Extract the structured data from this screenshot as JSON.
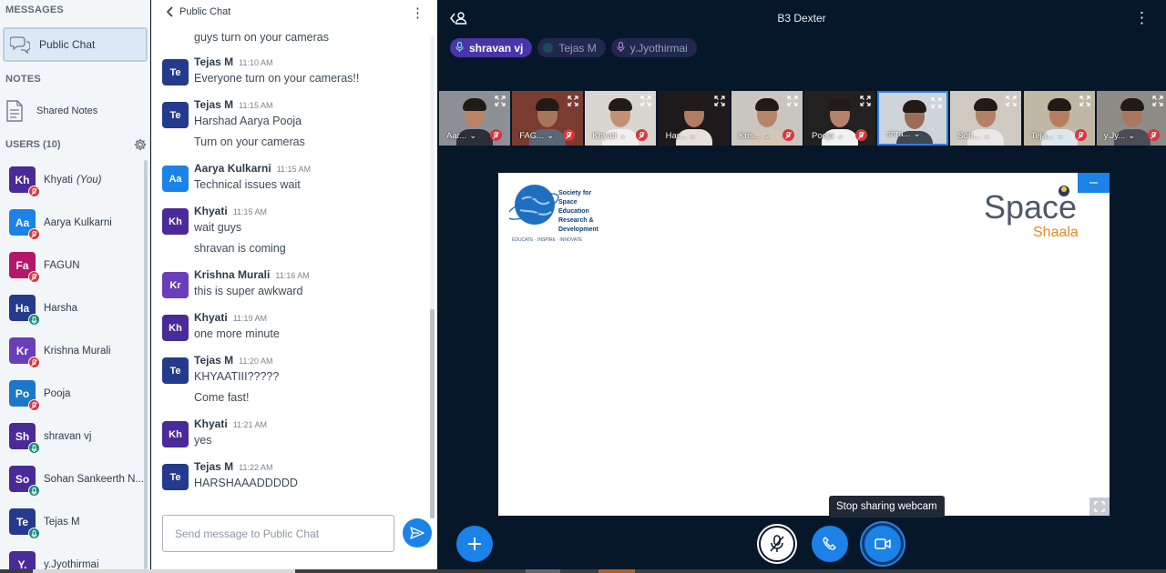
{
  "sidebar": {
    "messages_title": "MESSAGES",
    "public_chat_label": "Public Chat",
    "notes_title": "NOTES",
    "shared_notes_label": "Shared Notes",
    "users_title": "USERS (10)",
    "users": [
      {
        "initials": "Kh",
        "name": "Khyati",
        "suffix": "(You)",
        "color": "#4a2a99",
        "status": "muted"
      },
      {
        "initials": "Aa",
        "name": "Aarya Kulkarni",
        "suffix": "",
        "color": "#1b82e8",
        "status": "muted"
      },
      {
        "initials": "Fa",
        "name": "FAGUN",
        "suffix": "",
        "color": "#b5176b",
        "status": "muted"
      },
      {
        "initials": "Ha",
        "name": "Harsha",
        "suffix": "",
        "color": "#243a8c",
        "status": "mic"
      },
      {
        "initials": "Kr",
        "name": "Krishna Murali",
        "suffix": "",
        "color": "#6a3eb8",
        "status": "muted"
      },
      {
        "initials": "Po",
        "name": "Pooja",
        "suffix": "",
        "color": "#1c77c9",
        "status": "muted"
      },
      {
        "initials": "Sh",
        "name": "shravan vj",
        "suffix": "",
        "color": "#4a2a99",
        "status": "mic"
      },
      {
        "initials": "So",
        "name": "Sohan Sankeerth N...",
        "suffix": "",
        "color": "#4a2a99",
        "status": "mic"
      },
      {
        "initials": "Te",
        "name": "Tejas M",
        "suffix": "",
        "color": "#243a8c",
        "status": "mic"
      },
      {
        "initials": "Y.",
        "name": "y.Jyothirmai",
        "suffix": "",
        "color": "#4a2a99",
        "status": "mic"
      }
    ]
  },
  "chat": {
    "title": "Public Chat",
    "input_placeholder": "Send message to Public Chat",
    "messages": [
      {
        "initials": "",
        "name": "",
        "time": "",
        "color": "#243a8c",
        "lines": [
          "guys turn on your cameras"
        ]
      },
      {
        "initials": "Te",
        "name": "Tejas M",
        "time": "11:10 AM",
        "color": "#243a8c",
        "lines": [
          "Everyone turn on your cameras!!"
        ]
      },
      {
        "initials": "Te",
        "name": "Tejas M",
        "time": "11:15 AM",
        "color": "#243a8c",
        "lines": [
          "Harshad Aarya Pooja",
          "Turn on your cameras"
        ]
      },
      {
        "initials": "Aa",
        "name": "Aarya Kulkarni",
        "time": "11:15 AM",
        "color": "#1b82e8",
        "lines": [
          "Technical issues wait"
        ]
      },
      {
        "initials": "Kh",
        "name": "Khyati",
        "time": "11:15 AM",
        "color": "#4a2a99",
        "lines": [
          "wait guys",
          "shravan is coming"
        ]
      },
      {
        "initials": "Kr",
        "name": "Krishna Murali",
        "time": "11:16 AM",
        "color": "#6a3eb8",
        "lines": [
          "this is super awkward"
        ]
      },
      {
        "initials": "Kh",
        "name": "Khyati",
        "time": "11:19 AM",
        "color": "#4a2a99",
        "lines": [
          "one more minute"
        ]
      },
      {
        "initials": "Te",
        "name": "Tejas M",
        "time": "11:20 AM",
        "color": "#243a8c",
        "lines": [
          "KHYAATIII?????",
          "Come fast!"
        ]
      },
      {
        "initials": "Kh",
        "name": "Khyati",
        "time": "11:21 AM",
        "color": "#4a2a99",
        "lines": [
          "yes"
        ]
      },
      {
        "initials": "Te",
        "name": "Tejas M",
        "time": "11:22 AM",
        "color": "#243a8c",
        "lines": [
          "HARSHAAADDDDD"
        ]
      }
    ]
  },
  "main": {
    "meeting_title": "B3 Dexter",
    "talkers": [
      {
        "name": "shravan vj",
        "active": true,
        "icon": "mic-icon"
      },
      {
        "name": "Tejas M",
        "active": false,
        "icon": "dot"
      },
      {
        "name": "y.Jyothirmai",
        "active": false,
        "icon": "mic-icon"
      }
    ],
    "webcams": [
      {
        "name": "Aar...",
        "muted": true,
        "bg": "#8d8f96",
        "shirt": "#2d2f38",
        "skin": "#b98466"
      },
      {
        "name": "FAG...",
        "muted": true,
        "bg": "#7a3b31",
        "shirt": "#5c6775",
        "skin": "#a8765c"
      },
      {
        "name": "Khyati",
        "muted": true,
        "bg": "#d9d5cf",
        "shirt": "#f1f0ef",
        "skin": "#c39075"
      },
      {
        "name": "Har...",
        "muted": false,
        "bg": "#1e1a1c",
        "shirt": "#e6e1dc",
        "skin": "#b17c60"
      },
      {
        "name": "Kris...",
        "muted": true,
        "bg": "#c9c6c0",
        "shirt": "#d2c6b8",
        "skin": "#b88467"
      },
      {
        "name": "Pooja",
        "muted": true,
        "bg": "#23211f",
        "shirt": "#f2f2f2",
        "skin": "#b5826a"
      },
      {
        "name": "shra...",
        "muted": false,
        "bg": "#cfd4d9",
        "shirt": "#3e4752",
        "skin": "#9c6d55"
      },
      {
        "name": "Soh...",
        "muted": false,
        "bg": "#cec9c1",
        "shirt": "#e9e8e6",
        "skin": "#b48066"
      },
      {
        "name": "Teja...",
        "muted": true,
        "bg": "#c1b7a5",
        "shirt": "#dfe7ee",
        "skin": "#b57e60"
      },
      {
        "name": "y.Jy...",
        "muted": true,
        "bg": "#8e8c86",
        "shirt": "#4b4c58",
        "skin": "#aa775e"
      }
    ],
    "presentation": {
      "left_logo_lines": [
        "Society for",
        "Space",
        "Education",
        "Research &",
        "Development"
      ],
      "left_logo_tagline": "EDUCATE · INSPIRE · INNOVATE",
      "right_logo_word1": "Space",
      "right_logo_word2": "Shaala"
    },
    "minimize_label": "–",
    "tooltip": "Stop sharing webcam"
  },
  "colors": {
    "accent": "#1b82e8",
    "dark_bg": "#06172a",
    "muted_red": "#d9363e",
    "mic_teal": "#128a79"
  }
}
